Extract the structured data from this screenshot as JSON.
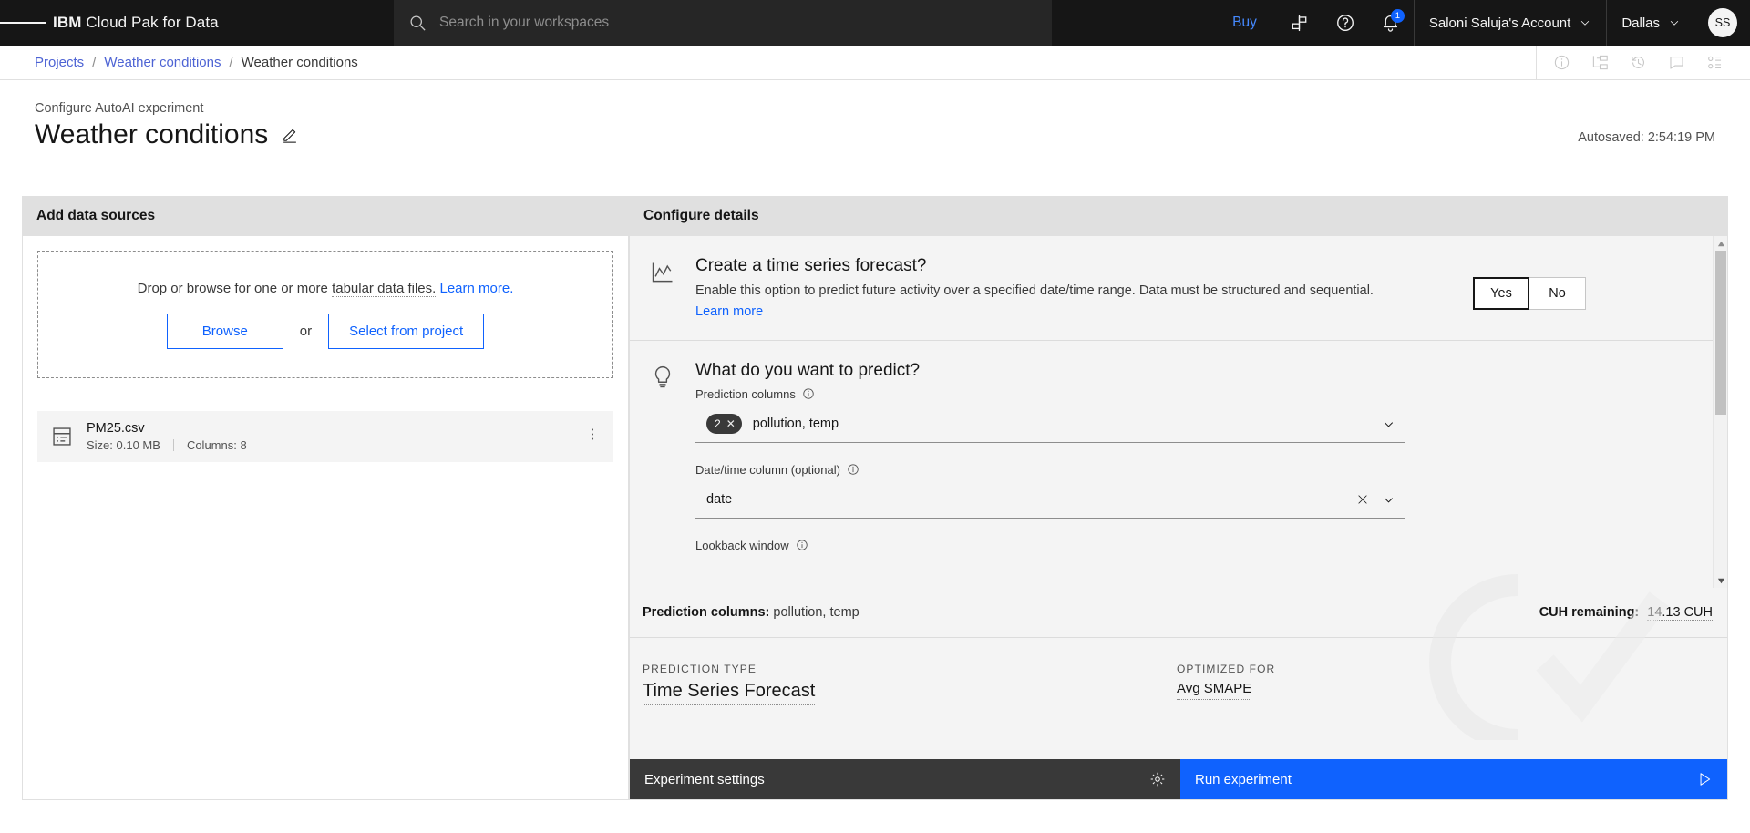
{
  "header": {
    "brand_prefix": "IBM ",
    "brand_rest": "Cloud Pak for Data",
    "menu_icon": "hamburger-icon",
    "search_placeholder": "Search in your workspaces",
    "search_value": "",
    "buy_label": "Buy",
    "notification_count": "1",
    "account_label": "Saloni Saluja's Account",
    "region_label": "Dallas",
    "avatar_initials": "SS"
  },
  "breadcrumb": {
    "items": [
      {
        "label": "Projects",
        "current": false
      },
      {
        "label": "Weather conditions",
        "current": false
      },
      {
        "label": "Weather conditions",
        "current": true
      }
    ],
    "separator": "/"
  },
  "page": {
    "eyebrow": "Configure AutoAI experiment",
    "title": "Weather conditions",
    "autosaved": "Autosaved: 2:54:19 PM"
  },
  "left_panel": {
    "heading": "Add data sources",
    "dropzone": {
      "text_before": "Drop or browse for one or more",
      "tip_text": "tabular data files.",
      "learn_more": "Learn more.",
      "browse_label": "Browse",
      "or_label": "or",
      "select_project_label": "Select from project"
    },
    "file": {
      "name": "PM25.csv",
      "size": "Size: 0.10 MB",
      "columns": "Columns: 8"
    }
  },
  "right_panel": {
    "heading": "Configure details",
    "timeseries": {
      "title": "Create a time series forecast?",
      "description": "Enable this option to predict future activity over a specified date/time range. Data must be structured and sequential.",
      "learn_more": "Learn more",
      "yes_label": "Yes",
      "no_label": "No",
      "selected": "Yes"
    },
    "predict": {
      "title": "What do you want to predict?",
      "prediction_columns_label": "Prediction columns",
      "prediction_columns_count": "2",
      "prediction_columns_value": "pollution, temp",
      "datetime_label": "Date/time column (optional)",
      "datetime_value": "date",
      "lookback_label": "Lookback window"
    },
    "summary": {
      "prediction_columns_label": "Prediction columns:",
      "prediction_columns_value": "pollution, temp",
      "cuh_label": "CUH remaining:",
      "cuh_value": "14.13 CUH"
    },
    "types": {
      "prediction_type_label": "PREDICTION TYPE",
      "prediction_type_value": "Time Series Forecast",
      "optimized_for_label": "OPTIMIZED FOR",
      "optimized_for_value": "Avg SMAPE"
    },
    "actions": {
      "settings_label": "Experiment settings",
      "run_label": "Run experiment"
    }
  },
  "colors": {
    "brand_blue": "#0f62fe",
    "link_blue": "#4d63d4",
    "header_black": "#161616",
    "panel_gray": "#f4f4f4"
  }
}
